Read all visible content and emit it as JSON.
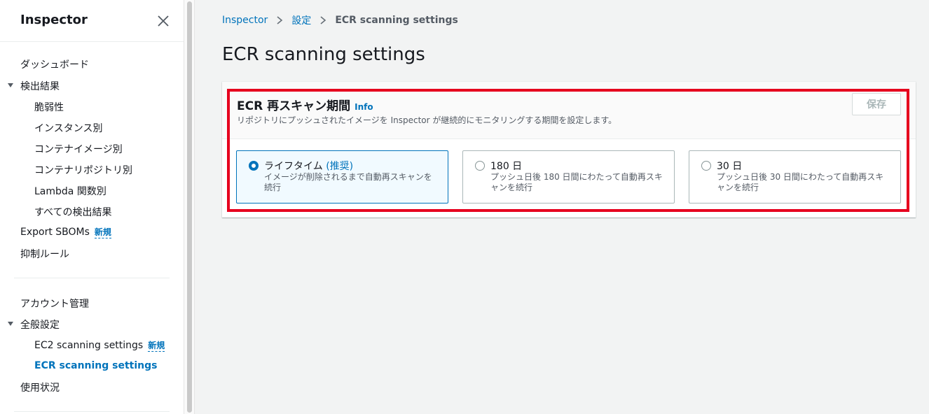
{
  "sidebar": {
    "title": "Inspector",
    "nav": {
      "dashboard": "ダッシュボード",
      "findings": "検出結果",
      "vulnerability": "脆弱性",
      "by_instance": "インスタンス別",
      "by_container_image": "コンテナイメージ別",
      "by_container_repo": "コンテナリポジトリ別",
      "by_lambda": "Lambda 関数別",
      "all_findings": "すべての検出結果",
      "export_sboms": "Export SBOMs",
      "suppression_rules": "抑制ルール",
      "account_management": "アカウント管理",
      "general_settings": "全般設定",
      "ec2_scanning": "EC2 scanning settings",
      "ecr_scanning": "ECR scanning settings",
      "usage": "使用状況"
    },
    "new_badge": "新規"
  },
  "breadcrumb": {
    "root": "Inspector",
    "settings": "設定",
    "current": "ECR scanning settings"
  },
  "page": {
    "title": "ECR scanning settings"
  },
  "panel": {
    "title": "ECR 再スキャン期間",
    "info": "Info",
    "description": "リポジトリにプッシュされたイメージを Inspector が継続的にモニタリングする期間を設定します。",
    "save_label": "保存",
    "options": [
      {
        "label": "ライフタイム",
        "recommended": "(推奨)",
        "description": "イメージが削除されるまで自動再スキャンを続行",
        "selected": true
      },
      {
        "label": "180 日",
        "description": "プッシュ日後 180 日間にわたって自動再スキャンを続行",
        "selected": false
      },
      {
        "label": "30 日",
        "description": "プッシュ日後 30 日間にわたって自動再スキャンを続行",
        "selected": false
      }
    ]
  },
  "colors": {
    "accent": "#0073bb",
    "highlight": "#e6001e"
  }
}
